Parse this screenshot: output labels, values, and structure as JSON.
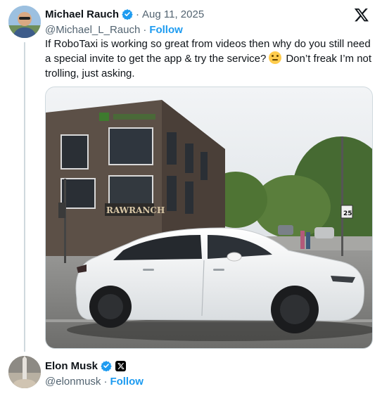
{
  "tweet1": {
    "author_name": "Michael Rauch",
    "handle": "@Michael_L_Rauch",
    "date": "Aug 11, 2025",
    "separator": "·",
    "follow_label": "Follow",
    "text_before_emoji": "If RoboTaxi is working so great from videos then why do you still need a special invite to get the app & try the service?",
    "text_after_emoji": "Don’t freak I’m not trolling, just asking.",
    "emoji": "thinking-face",
    "photo_sign_text": "RAWRANCH",
    "photo_speed_sign": "25"
  },
  "tweet2": {
    "author_name": "Elon Musk",
    "handle": "@elonmusk",
    "separator": "·",
    "follow_label": "Follow"
  },
  "colors": {
    "verified": "#1d9bf0",
    "follow": "#1d9bf0",
    "secondary_text": "#536471",
    "thread_line": "#cfd9de"
  }
}
